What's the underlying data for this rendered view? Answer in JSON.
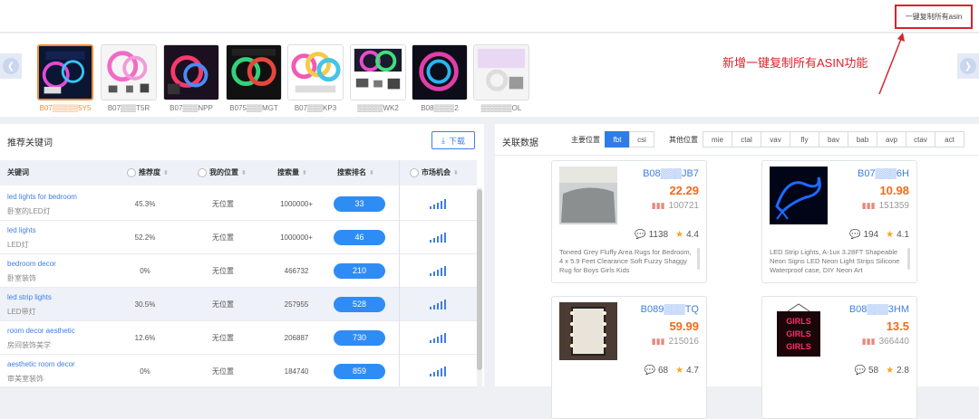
{
  "topbar": {
    "copy_button": "一键复制所有asin"
  },
  "annotation": "新增一键复制所有ASIN功能",
  "carousel": {
    "items": [
      {
        "label": "B07▒▒▒▒▒5Y5",
        "selected": true
      },
      {
        "label": "B07▒▒▒T5R",
        "selected": false
      },
      {
        "label": "B07▒▒▒NPP",
        "selected": false
      },
      {
        "label": "B075▒▒▒MGT",
        "selected": false
      },
      {
        "label": "B07▒▒▒KP3",
        "selected": false
      },
      {
        "label": "▒▒▒▒▒WK2",
        "selected": false
      },
      {
        "label": "B08▒▒▒▒2",
        "selected": false
      },
      {
        "label": "▒▒▒▒▒▒OL",
        "selected": false
      }
    ]
  },
  "keywords": {
    "title": "推荐关键词",
    "download": "下载",
    "columns": {
      "keyword": "关键词",
      "recommend": "推荐度",
      "position": "我的位置",
      "volume": "搜索量",
      "rank": "搜索排名",
      "opportunity": "市场机会"
    },
    "rows": [
      {
        "kw": "led lights for bedroom",
        "kw_cn": "卧室的LED灯",
        "recommend": "45.3%",
        "position": "无位置",
        "volume": "1000000+",
        "rank": "33",
        "opportunity": 4,
        "highlight": false
      },
      {
        "kw": "led lights",
        "kw_cn": "LED灯",
        "recommend": "52.2%",
        "position": "无位置",
        "volume": "1000000+",
        "rank": "46",
        "opportunity": 4,
        "highlight": false
      },
      {
        "kw": "bedroom decor",
        "kw_cn": "卧室装饰",
        "recommend": "0%",
        "position": "无位置",
        "volume": "466732",
        "rank": "210",
        "opportunity": 4,
        "highlight": false
      },
      {
        "kw": "led strip lights",
        "kw_cn": "LED带灯",
        "recommend": "30.5%",
        "position": "无位置",
        "volume": "257955",
        "rank": "528",
        "opportunity": 4,
        "highlight": true
      },
      {
        "kw": "room decor aesthetic",
        "kw_cn": "房间装饰美学",
        "recommend": "12.6%",
        "position": "无位置",
        "volume": "206887",
        "rank": "730",
        "opportunity": 4,
        "highlight": false
      },
      {
        "kw": "aesthetic room decor",
        "kw_cn": "审美室装饰",
        "recommend": "0%",
        "position": "无位置",
        "volume": "184740",
        "rank": "859",
        "opportunity": 4,
        "highlight": false
      }
    ]
  },
  "related": {
    "title": "关联数据",
    "main_label": "主要位置",
    "main_tabs": [
      "fbt",
      "csi"
    ],
    "other_label": "其他位置",
    "other_tabs": [
      "mie",
      "ctal",
      "vav",
      "fly",
      "bav",
      "bab",
      "avp",
      "ctav",
      "act"
    ],
    "cards": [
      {
        "asin": "B08▒▒▒JB7",
        "price": "22.29",
        "sales": "100721",
        "comments": "1138",
        "rating": "4.4",
        "desc": "Toneed Grey Fluffy Area Rugs for Bedroom, 4 x 5.9 Feet Clearance Soft Fuzzy Shaggy Rug for Boys Girls Kids"
      },
      {
        "asin": "B07▒▒▒6H",
        "price": "10.98",
        "sales": "151359",
        "comments": "194",
        "rating": "4.1",
        "desc": "LED Strip Lights, A-1ux 3.28FT Shapeable Neon Signs LED Neon Light Strips Silicone Waterproof case, DIY Neon Art"
      },
      {
        "asin": "B089▒▒▒TQ",
        "price": "59.99",
        "sales": "215016",
        "comments": "68",
        "rating": "4.7",
        "desc": ""
      },
      {
        "asin": "B08▒▒▒3HM",
        "price": "13.5",
        "sales": "366440",
        "comments": "58",
        "rating": "2.8",
        "desc": "",
        "sign_text": "GIRLS"
      }
    ]
  }
}
